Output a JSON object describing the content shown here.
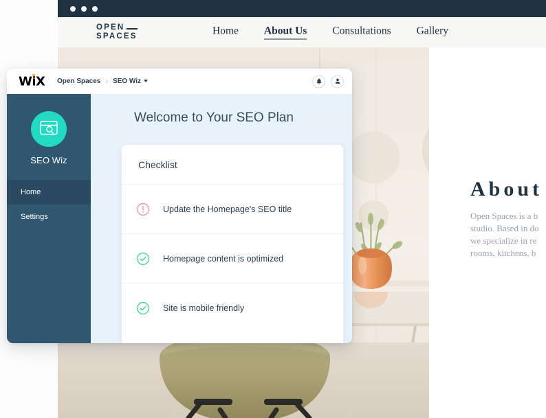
{
  "browser": {
    "window_dots": [
      "dot-1",
      "dot-2",
      "dot-3"
    ]
  },
  "site": {
    "logo": {
      "line1": "OPEN",
      "line2": "SPACES"
    },
    "nav": [
      {
        "label": "Home",
        "active": false
      },
      {
        "label": "About Us",
        "active": true
      },
      {
        "label": "Consultations",
        "active": false
      },
      {
        "label": "Gallery",
        "active": false
      }
    ],
    "about": {
      "title": "About",
      "body": "Open Spaces is a b\nstudio. Based in do\nwe specialize in re\nrooms, kitchens, b"
    }
  },
  "wix": {
    "logo": "WiX",
    "breadcrumb": {
      "site": "Open Spaces",
      "separator": "›",
      "app": "SEO Wiz"
    },
    "actions": [
      {
        "name": "notifications-button",
        "icon": "bell-icon"
      },
      {
        "name": "account-button",
        "icon": "person-icon"
      }
    ],
    "sidebar": {
      "app_name": "SEO Wiz",
      "app_icon": "seo-window-search-icon",
      "items": [
        {
          "label": "Home",
          "active": true
        },
        {
          "label": "Settings",
          "active": false
        }
      ]
    },
    "main": {
      "heading": "Welcome to Your SEO Plan",
      "card": {
        "title": "Checklist",
        "items": [
          {
            "text": "Update the Homepage's SEO title",
            "status": "warning",
            "icon": "alert-circle-icon"
          },
          {
            "text": "Homepage content is optimized",
            "status": "done",
            "icon": "check-circle-icon"
          },
          {
            "text": "Site is mobile friendly",
            "status": "done",
            "icon": "check-circle-icon"
          }
        ]
      }
    }
  },
  "colors": {
    "chrome_bar": "#1f3240",
    "site_nav_bg": "#f7f7f6",
    "brand_navy": "#1f3240",
    "sidebar_navy": "#31566f",
    "sidebar_active": "#2a4a61",
    "avatar_teal": "#22d9c4",
    "content_blue": "#e7f2fb",
    "status_warning": "#f28ba0",
    "status_done": "#2ed88f",
    "wix_dot_orange": "#fbb03b"
  }
}
